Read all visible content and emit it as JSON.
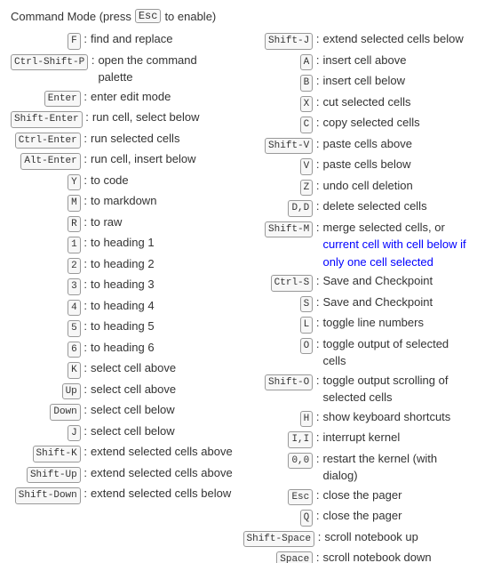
{
  "title": "Command Mode (press",
  "title_key": "Esc",
  "title_suffix": "to enable)",
  "left_col": [
    {
      "key": "F",
      "desc": "find and replace"
    },
    {
      "key": "Ctrl-Shift-P",
      "desc": "open the command palette"
    },
    {
      "key": "Enter",
      "desc": "enter edit mode"
    },
    {
      "key": "Shift-Enter",
      "desc": "run cell, select below"
    },
    {
      "key": "Ctrl-Enter",
      "desc": "run selected cells"
    },
    {
      "key": "Alt-Enter",
      "desc": "run cell, insert below"
    },
    {
      "key": "Y",
      "desc": "to code"
    },
    {
      "key": "M",
      "desc": "to markdown"
    },
    {
      "key": "R",
      "desc": "to raw"
    },
    {
      "key": "1",
      "desc": "to heading 1"
    },
    {
      "key": "2",
      "desc": "to heading 2"
    },
    {
      "key": "3",
      "desc": "to heading 3"
    },
    {
      "key": "4",
      "desc": "to heading 4"
    },
    {
      "key": "5",
      "desc": "to heading 5"
    },
    {
      "key": "6",
      "desc": "to heading 6"
    },
    {
      "key": "K",
      "desc": "select cell above"
    },
    {
      "key": "Up",
      "desc": "select cell above"
    },
    {
      "key": "Down",
      "desc": "select cell below"
    },
    {
      "key": "J",
      "desc": "select cell below"
    },
    {
      "key": "Shift-K",
      "desc": "extend selected cells above"
    },
    {
      "key": "Shift-Up",
      "desc": "extend selected cells above"
    },
    {
      "key": "Shift-Down",
      "desc": "extend selected cells below"
    }
  ],
  "right_col": [
    {
      "key": "Shift-J",
      "desc": "extend selected cells below"
    },
    {
      "key": "A",
      "desc": "insert cell above"
    },
    {
      "key": "B",
      "desc": "insert cell below"
    },
    {
      "key": "X",
      "desc": "cut selected cells"
    },
    {
      "key": "C",
      "desc": "copy selected cells"
    },
    {
      "key": "Shift-V",
      "desc": "paste cells above"
    },
    {
      "key": "V",
      "desc": "paste cells below"
    },
    {
      "key": "Z",
      "desc": "undo cell deletion"
    },
    {
      "key": "D,D",
      "desc": "delete selected cells"
    },
    {
      "key": "Shift-M",
      "desc": "merge selected cells, or current cell with cell below if only one cell selected",
      "multi": true
    },
    {
      "key": "Ctrl-S",
      "desc": "Save and Checkpoint"
    },
    {
      "key": "S",
      "desc": "Save and Checkpoint"
    },
    {
      "key": "L",
      "desc": "toggle line numbers"
    },
    {
      "key": "O",
      "desc": "toggle output of selected cells",
      "multi": true
    },
    {
      "key": "Shift-O",
      "desc": "toggle output scrolling of selected cells",
      "multi": true
    },
    {
      "key": "H",
      "desc": "show keyboard shortcuts"
    },
    {
      "key": "I,I",
      "desc": "interrupt kernel"
    },
    {
      "key": "0,0",
      "desc": "restart the kernel (with dialog)",
      "multi": true
    },
    {
      "key": "Esc",
      "desc": "close the pager"
    },
    {
      "key": "Q",
      "desc": "close the pager"
    },
    {
      "key": "Shift-Space",
      "desc": "scroll notebook up"
    },
    {
      "key": "Space",
      "desc": "scroll notebook down"
    }
  ]
}
